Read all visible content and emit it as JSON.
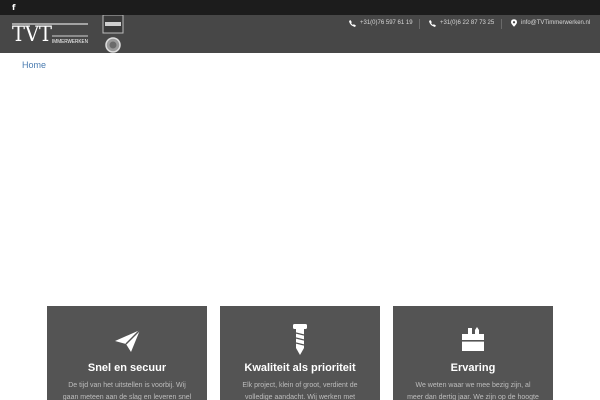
{
  "social": {
    "facebook_glyph": "f"
  },
  "header": {
    "logo_text": "TVT",
    "logo_subtext": "IMMERWERKEN",
    "phone1": "+31(0)76 597 61 19",
    "phone2": "+31(0)6 22 87 73 25",
    "email": "info@TVTimmerwerken.nl"
  },
  "breadcrumb": {
    "home": "Home"
  },
  "cards": [
    {
      "icon": "paper-plane-icon",
      "title": "Snel en secuur",
      "text": "De tijd van het uitstellen is voorbij. Wij gaan meteen aan de slag en leveren snel"
    },
    {
      "icon": "screw-icon",
      "title": "Kwaliteit als prioriteit",
      "text": "Elk project, klein of groot, verdient de volledige aandacht. Wij werken met"
    },
    {
      "icon": "toolbox-icon",
      "title": "Ervaring",
      "text": "We weten waar we mee bezig zijn, al meer dan dertig jaar. We zijn op de hoogte van"
    }
  ],
  "colors": {
    "topbar": "#1c1c1c",
    "header": "#474747",
    "card": "#545454",
    "link": "#4a7bb0"
  }
}
